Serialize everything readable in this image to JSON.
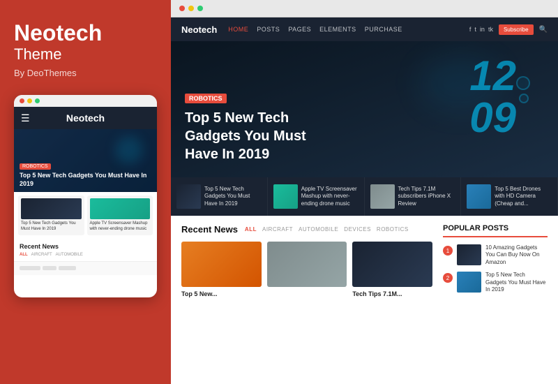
{
  "leftPanel": {
    "brandName": "Neotech",
    "brandSub": "Theme",
    "byLine": "By DeoThemes"
  },
  "mobileMockup": {
    "navTitle": "Neotech",
    "heroBadge": "ROBOTICS",
    "heroTitle": "Top 5 New Tech Gadgets You Must Have In 2019",
    "article1Title": "Top 5 New Tech Gadgets You Must Have In 2019",
    "article2Title": "Apple TV Screensaver Mashup with never-ending drone music",
    "recentNewsTitle": "Recent News",
    "tabs": [
      "ALL",
      "AIRCRAFT",
      "AUTOMOBILE"
    ]
  },
  "browser": {
    "siteLogo": "Neotech",
    "navLinks": [
      "HOME",
      "POSTS",
      "PAGES",
      "ELEMENTS",
      "PURCHASE"
    ],
    "subscribeLabel": "Subscribe",
    "heroCategory": "ROBOTICS",
    "heroTitle": "Top 5 New Tech Gadgets You Must Have In 2019",
    "heroNumber": "12\n09",
    "thumbs": [
      {
        "title": "Top 5 New Tech Gadgets You Must Have In 2019"
      },
      {
        "title": "Apple TV Screensaver Mashup with never-ending drone music"
      },
      {
        "title": "Tech Tips 7.1M subscribers iPhone X Review"
      },
      {
        "title": "Top 5 Best Drones with HD Camera (Cheap and..."
      }
    ],
    "recentNews": {
      "title": "Recent News",
      "tabs": [
        "ALL",
        "AIRCRAFT",
        "AUTOMOBILE",
        "DEVICES",
        "ROBOTICS"
      ],
      "activeTab": "ALL",
      "cards": [
        {
          "label": "",
          "title": "Top 5 New..."
        },
        {
          "label": "",
          "title": ""
        },
        {
          "label": "",
          "title": "Tech Tips 7.1M..."
        }
      ]
    },
    "popularPosts": {
      "title": "POPULAR POSTS",
      "items": [
        {
          "num": "1",
          "title": "10 Amazing Gadgets You Can Buy Now On Amazon"
        },
        {
          "num": "2",
          "title": "Top 5 New Tech Gadgets You Must Have In 2019"
        }
      ]
    }
  },
  "browserDots": [
    "#e74c3c",
    "#f1c40f",
    "#2ecc71"
  ]
}
